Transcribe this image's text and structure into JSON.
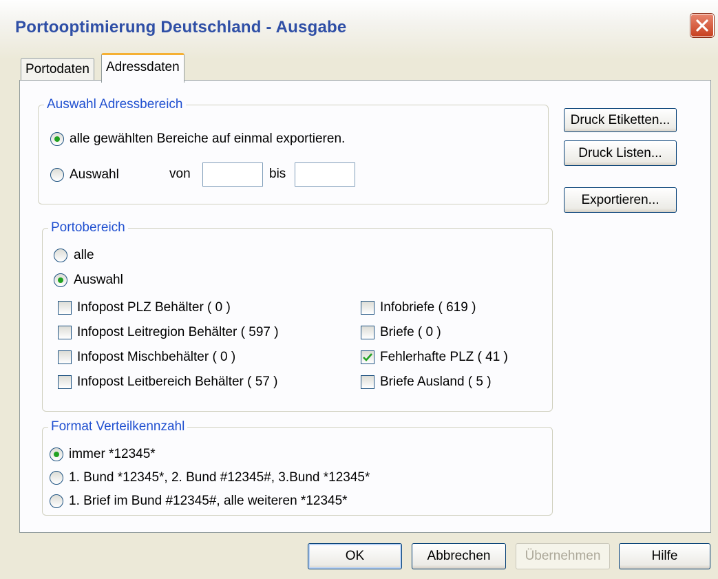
{
  "window": {
    "title": "Portooptimierung Deutschland - Ausgabe",
    "close_icon": "close-icon"
  },
  "tabs": [
    {
      "label": "Portodaten",
      "active": false
    },
    {
      "label": "Adressdaten",
      "active": true
    }
  ],
  "auswahl_adressbereich": {
    "title": "Auswahl Adressbereich",
    "option_all": {
      "label": "alle gewählten Bereiche auf einmal exportieren.",
      "selected": true
    },
    "option_auswahl": {
      "label": "Auswahl",
      "selected": false
    },
    "von_label": "von",
    "von_value": "",
    "bis_label": "bis",
    "bis_value": ""
  },
  "portobereich": {
    "title": "Portobereich",
    "option_alle": {
      "label": "alle",
      "selected": false
    },
    "option_auswahl": {
      "label": "Auswahl",
      "selected": true
    },
    "checkboxes_left": [
      {
        "label": "Infopost PLZ Behälter ( 0 )",
        "checked": false
      },
      {
        "label": "Infopost Leitregion Behälter ( 597 )",
        "checked": false
      },
      {
        "label": "Infopost Mischbehälter ( 0 )",
        "checked": false
      },
      {
        "label": "Infopost Leitbereich Behälter ( 57 )",
        "checked": false
      }
    ],
    "checkboxes_right": [
      {
        "label": "Infobriefe ( 619 )",
        "checked": false
      },
      {
        "label": "Briefe ( 0 )",
        "checked": false
      },
      {
        "label": "Fehlerhafte PLZ ( 41 )",
        "checked": true
      },
      {
        "label": "Briefe Ausland ( 5 )",
        "checked": false
      }
    ]
  },
  "format_verteilkennzahl": {
    "title": "Format Verteilkennzahl",
    "options": [
      {
        "label": "immer *12345*",
        "selected": true
      },
      {
        "label": "1. Bund *12345*, 2. Bund #12345#, 3.Bund *12345*",
        "selected": false
      },
      {
        "label": "1. Brief im Bund #12345#, alle weiteren *12345*",
        "selected": false
      }
    ]
  },
  "side_buttons": {
    "druck_etiketten": "Druck Etiketten...",
    "druck_listen": "Druck Listen...",
    "exportieren": "Exportieren..."
  },
  "footer_buttons": {
    "ok": "OK",
    "abbrechen": "Abbrechen",
    "uebernehmen": "Übernehmen",
    "hilfe": "Hilfe"
  },
  "colors": {
    "title_text": "#2f4fa6",
    "group_title": "#2050d0",
    "active_tab_accent": "#f5b034",
    "radio_dot": "#21a121",
    "check_mark": "#21a121"
  }
}
